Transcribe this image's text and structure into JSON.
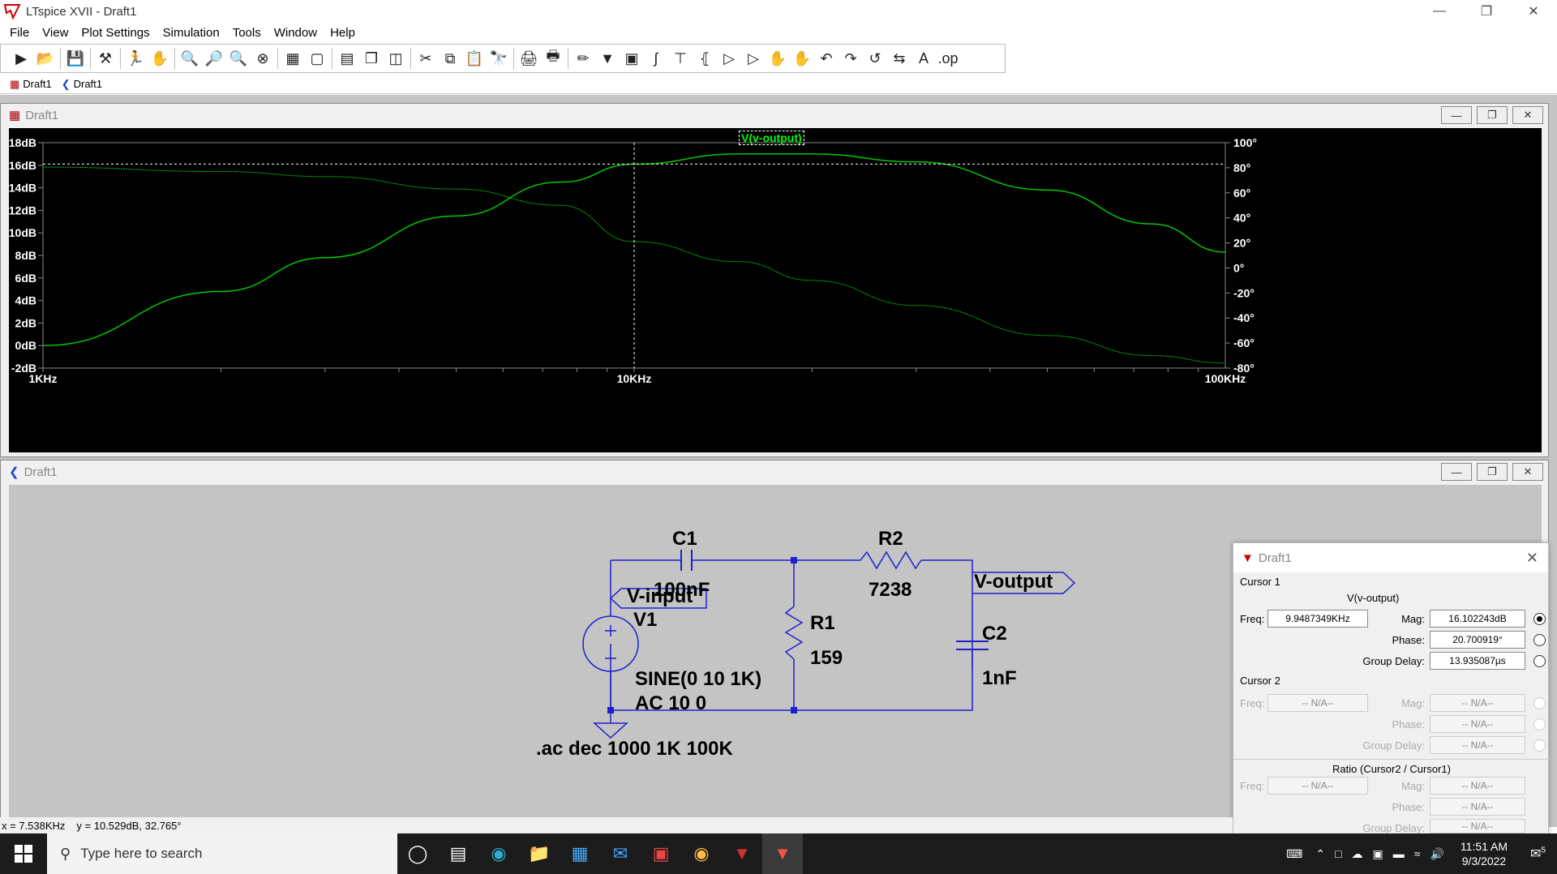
{
  "window": {
    "title": "LTspice XVII - Draft1"
  },
  "menu": [
    "File",
    "View",
    "Plot Settings",
    "Simulation",
    "Tools",
    "Window",
    "Help"
  ],
  "tabs": [
    "Draft1",
    "Draft1"
  ],
  "plot_window": {
    "title": "Draft1",
    "trace_label": "V(v-output)",
    "y_left": [
      "18dB",
      "16dB",
      "14dB",
      "12dB",
      "10dB",
      "8dB",
      "6dB",
      "4dB",
      "2dB",
      "0dB",
      "-2dB"
    ],
    "y_right": [
      "100°",
      "80°",
      "60°",
      "40°",
      "20°",
      "0°",
      "-20°",
      "-40°",
      "-60°",
      "-80°"
    ],
    "x": [
      "1KHz",
      "10KHz",
      "100KHz"
    ]
  },
  "chart_data": {
    "type": "line",
    "x_scale": "log",
    "xlim": [
      "1KHz",
      "100KHz"
    ],
    "ylim_left": [
      -2,
      18
    ],
    "ylim_right": [
      -80,
      100
    ],
    "series": [
      {
        "name": "V(v-output)",
        "axis": "left",
        "unit": "dB",
        "x": [
          "1KHz",
          "2KHz",
          "3KHz",
          "5KHz",
          "7.5KHz",
          "10KHz",
          "15KHz",
          "20KHz",
          "30KHz",
          "50KHz",
          "75KHz",
          "100KHz"
        ],
        "values": [
          0.0,
          4.8,
          7.8,
          11.5,
          14.5,
          16.1,
          17.0,
          17.0,
          16.3,
          13.8,
          10.8,
          8.3
        ]
      },
      {
        "name": "V(v-output)",
        "axis": "right",
        "unit": "°",
        "x": [
          "1KHz",
          "2KHz",
          "3KHz",
          "5KHz",
          "7.5KHz",
          "10KHz",
          "15KHz",
          "20KHz",
          "30KHz",
          "50KHz",
          "75KHz",
          "100KHz"
        ],
        "values": [
          80.5,
          77,
          73,
          63,
          50,
          21,
          5,
          -10,
          -30,
          -54,
          -70,
          -76
        ]
      }
    ],
    "cursor": {
      "x": "10KHz",
      "y": 16.1
    }
  },
  "schematic_window": {
    "title": "Draft1",
    "components": {
      "c1": "C1",
      "c1_val": "100nF",
      "r2": "R2",
      "r2_val": "7238",
      "r1": "R1",
      "r1_val": "159",
      "c2": "C2",
      "c2_val": "1nF",
      "v1": "V1",
      "v1_val1": "SINE(0 10 1K)",
      "v1_val2": "AC 10 0"
    },
    "labels": {
      "input": "V-input",
      "output": "V-output"
    },
    "directive": ".ac dec 1000 1K 100K"
  },
  "cursor_window": {
    "title": "Draft1",
    "cursor1": "Cursor 1",
    "trace": "V(v-output)",
    "freq_label": "Freq:",
    "freq": "9.9487349KHz",
    "mag_label": "Mag:",
    "mag": "16.102243dB",
    "phase_label": "Phase:",
    "phase": "20.700919°",
    "gd_label": "Group Delay:",
    "gd": "13.935087µs",
    "cursor2": "Cursor 2",
    "na": "-- N/A--",
    "ratio": "Ratio (Cursor2 / Cursor1)"
  },
  "status": {
    "x": "x = 7.538KHz",
    "y": "y = 10.529dB, 32.765°"
  },
  "taskbar": {
    "search_placeholder": "Type here to search",
    "time": "11:51 AM",
    "date": "9/3/2022",
    "notif_count": "5"
  }
}
